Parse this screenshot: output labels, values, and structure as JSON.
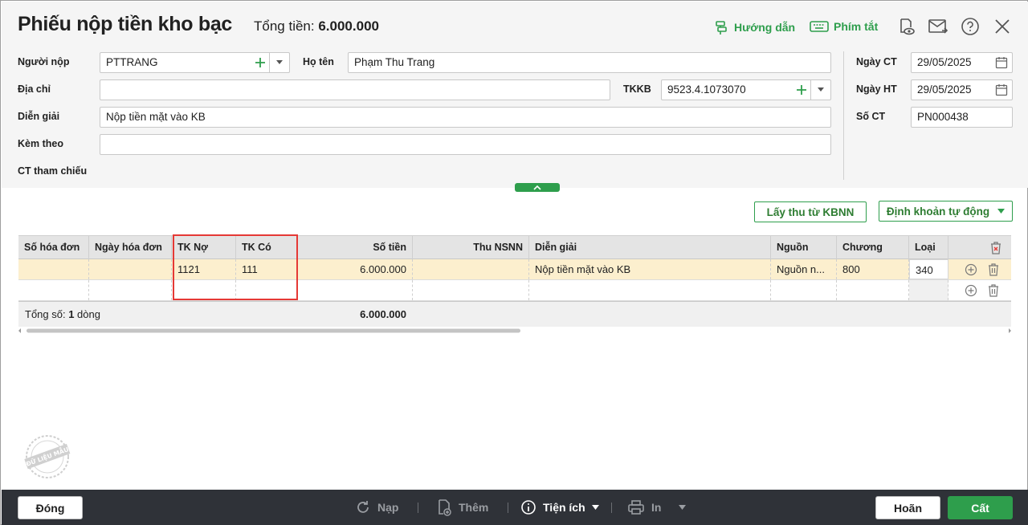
{
  "header": {
    "title": "Phiếu nộp tiền kho bạc",
    "total_label": "Tổng tiền:",
    "total_value": "6.000.000",
    "guide_label": "Hướng dẫn",
    "shortcut_label": "Phím tắt"
  },
  "form": {
    "payer_label": "Người nộp",
    "payer_value": "PTTRANG",
    "name_label": "Họ tên",
    "name_value": "Phạm Thu Trang",
    "address_label": "Địa chỉ",
    "address_value": "",
    "tkkb_label": "TKKB",
    "tkkb_value": "9523.4.1073070",
    "desc_label": "Diễn giải",
    "desc_value": "Nộp tiền mặt vào KB",
    "attach_label": "Kèm theo",
    "attach_value": "",
    "ref_label": "CT tham chiếu",
    "date_ct_label": "Ngày CT",
    "date_ct_value": "29/05/2025",
    "date_ht_label": "Ngày HT",
    "date_ht_value": "29/05/2025",
    "so_ct_label": "Số CT",
    "so_ct_value": "PN000438"
  },
  "actions": {
    "fetch_label": "Lấy thu từ KBNN",
    "auto_label": "Định khoản tự động"
  },
  "grid": {
    "columns": [
      "Số hóa đơn",
      "Ngày hóa đơn",
      "TK Nợ",
      "TK Có",
      "Số tiền",
      "Thu NSNN",
      "Diễn giải",
      "Nguồn",
      "Chương",
      "Loại"
    ],
    "rows": [
      {
        "so_hd": "",
        "ngay_hd": "",
        "tk_no": "1121",
        "tk_co": "111",
        "so_tien": "6.000.000",
        "thu_nsnn": "",
        "dien_giai": "Nộp tiền mặt vào KB",
        "nguon": "Nguồn n...",
        "chuong": "800",
        "loai": "340"
      }
    ],
    "footer_prefix": "Tổng số: ",
    "footer_count": "1",
    "footer_suffix": " dòng",
    "footer_total": "6.000.000"
  },
  "watermark": "ĐỮ LIỆU MẪU",
  "footer": {
    "close_label": "Đóng",
    "reload_label": "Nạp",
    "add_label": "Thêm",
    "utility_label": "Tiện ích",
    "print_label": "In",
    "cancel_label": "Hoãn",
    "save_label": "Cất"
  },
  "colors": {
    "accent": "#2e9e4c",
    "selected_row": "#fcefce",
    "highlight": "#e53935",
    "footer_bg": "#2f3238"
  }
}
